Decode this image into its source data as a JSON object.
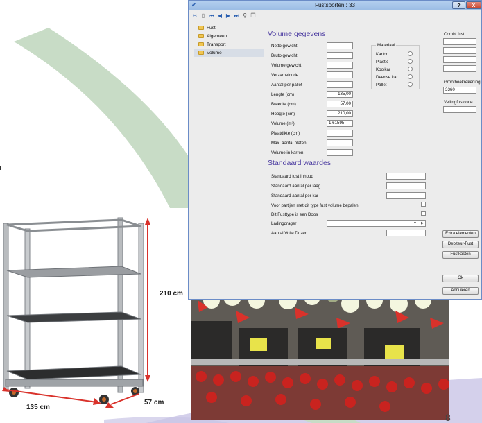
{
  "window": {
    "title": "Fustsoorten : 33",
    "help_label": "?",
    "close_label": "X"
  },
  "toolbar": {
    "icons": [
      "tools-icon",
      "delete-icon",
      "first-record-icon",
      "previous-record-icon",
      "next-record-icon",
      "last-record-icon",
      "search-icon",
      "copy-icon"
    ]
  },
  "tree": {
    "items": [
      "Fust",
      "Algemeen",
      "Transport",
      "Volume"
    ],
    "selected": "Volume"
  },
  "volume": {
    "heading": "Volume gegevens",
    "fields": [
      {
        "label": "Netto gewicht",
        "value": ""
      },
      {
        "label": "Bruto gewicht",
        "value": ""
      },
      {
        "label": "Volume gewicht",
        "value": ""
      },
      {
        "label": "Verzamelcode",
        "value": ""
      },
      {
        "label": "Aantal per pallet",
        "value": ""
      },
      {
        "label": "Lengte (cm)",
        "value": "135,00"
      },
      {
        "label": "Breedte (cm)",
        "value": "57,00"
      },
      {
        "label": "Hoogte (cm)",
        "value": "210,00"
      },
      {
        "label": "Volume (m³)",
        "value": "1,61595"
      },
      {
        "label": "Plaatdikte (cm)",
        "value": ""
      },
      {
        "label": "Max. aantal platen",
        "value": ""
      },
      {
        "label": "Volume in karren",
        "value": ""
      }
    ]
  },
  "materiaal": {
    "heading": "Materiaal",
    "options": [
      "Karton",
      "Plastic",
      "Kooikar",
      "Deense kar",
      "Pallet"
    ]
  },
  "right_panel": {
    "combi_label": "Combi fust",
    "grootboek_label": "Grootboekrekening",
    "grootboek_value": "3360",
    "veiling_label": "Veilingfustcode"
  },
  "standaard": {
    "heading": "Standaard waardes",
    "fields": [
      {
        "label": "Standaard fust Inhoud",
        "type": "text"
      },
      {
        "label": "Standaard aantal per laag",
        "type": "text"
      },
      {
        "label": "Standaard aantal per kar",
        "type": "text"
      },
      {
        "label": "Voor partijen met dit type fust volume bepalen",
        "type": "checkbox"
      },
      {
        "label": "Dit Fusttype is een Doos",
        "type": "checkbox"
      },
      {
        "label": "Ladingdrager",
        "type": "dropdown"
      },
      {
        "label": "Aantal Volle Dozen",
        "type": "text"
      }
    ]
  },
  "buttons": {
    "extra": "Extra elementen",
    "debiteur": "Debiteur-Fust",
    "fustkosten": "Fustkosten",
    "ok": "Ok",
    "annuleren": "Annuleren"
  },
  "cart_dims": {
    "height": "210 cm",
    "length": "135 cm",
    "depth": "57 cm"
  },
  "slide_number": "8",
  "colors": {
    "accent_purple": "#4a3aa0",
    "swoosh_green": "#c8dcc6",
    "swoosh_purple": "#c9c4e6",
    "arrow_red": "#d9322b"
  }
}
